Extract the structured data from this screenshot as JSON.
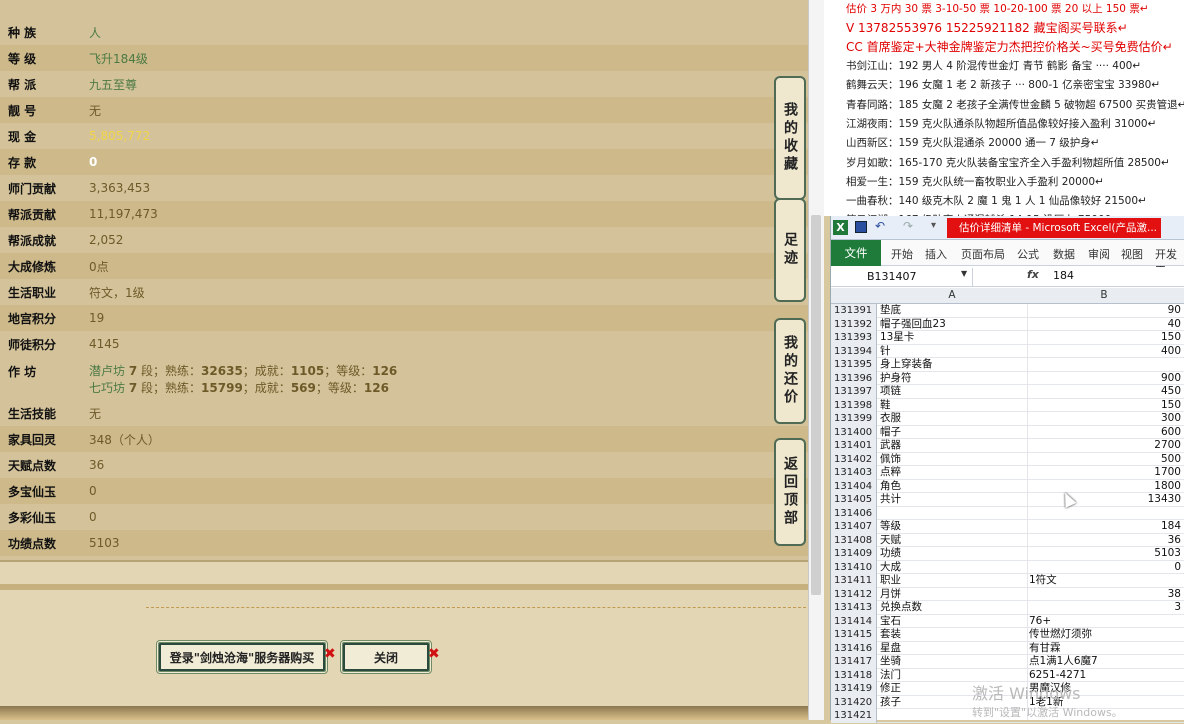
{
  "left_panel": {
    "rows": [
      {
        "label": "种 族",
        "value": "人"
      },
      {
        "label": "等 级",
        "value": "飞升184级"
      },
      {
        "label": "帮 派",
        "value": "九五至尊"
      },
      {
        "label": "靓 号",
        "value": "无"
      },
      {
        "label": "现 金",
        "value": "5,805,772"
      },
      {
        "label": "存 款",
        "value": "0"
      },
      {
        "label": "师门贡献",
        "value": "3,363,453"
      },
      {
        "label": "帮派贡献",
        "value": "11,197,473"
      },
      {
        "label": "帮派成就",
        "value": "2,052"
      },
      {
        "label": "大成修炼",
        "value": "0点"
      },
      {
        "label": "生活职业",
        "value": "符文，1级"
      },
      {
        "label": "地宫积分",
        "value": "19"
      },
      {
        "label": "师徒积分",
        "value": "4145"
      }
    ],
    "workshop": {
      "label": "作 坊",
      "line1": {
        "name": "潜卢坊",
        "level": "7",
        "level_suffix": "段；熟练：",
        "skill": "32635",
        "ach_label": "；成就：",
        "ach": "1105",
        "lv_label": "；等级：",
        "lv": "126"
      },
      "line2": {
        "name": "七巧坊",
        "level": "7",
        "level_suffix": "段；熟练：",
        "skill": "15799",
        "ach_label": "；成就：",
        "ach": "569",
        "lv_label": "；等级：",
        "lv": "126"
      }
    },
    "rows2": [
      {
        "label": "生活技能",
        "value": "无"
      },
      {
        "label": "家具回灵",
        "value": "348（个人）"
      },
      {
        "label": "天赋点数",
        "value": "36"
      },
      {
        "label": "多宝仙玉",
        "value": "0"
      },
      {
        "label": "多彩仙玉",
        "value": "0"
      },
      {
        "label": "功绩点数",
        "value": "5103"
      }
    ],
    "side_buttons": [
      "我的收藏",
      "足迹",
      "我的还价",
      "返回顶部"
    ],
    "login_button": "登录\"剑烛沧海\"服务器购买",
    "close_button": "关闭"
  },
  "right_text": {
    "line0": "估价 3 万内 30 票    3-10-50 票    10-20-100 票    20 以上 150 票↵",
    "line1": "V 13782553976    15225921182   藏宝阁买号联系↵",
    "line2": "CC 首席鉴定+大神金牌鉴定力杰把控价格关~买号免费估价↵",
    "lines": [
      "书剑江山：192 男人 4 阶混传世金灯 青节 鹤影 备宝 ···· 400↵",
      "鹤舞云天：196 女魔 1 老 2 新孩子 ··· 800-1 亿亲密宝宝 33980↵",
      "青春同路：185 女魔 2 老孩子全满传世金麟 5 破物超 67500 买贵管退↵",
      "江湖夜雨：159 克火队通杀队物超所值品像较好接入盈利 31000↵",
      "山西新区：159 克火队混通杀 20000 通一 7 级护身↵",
      "岁月如歌：165-170 克火队装备宝宝齐全入手盈利物超所值 28500↵",
      "相爱一生：159 克火队统一畜牧职业入手盈利 20000↵",
      "一曲春秋：140 级克木队 2 魔 1 鬼 1 人 1 仙品像较好 21500↵",
      "笑马江湖：167 级队克火通混辅杀 14-15 没压力 75000↵"
    ]
  },
  "excel": {
    "title": "估价详细清单 - Microsoft Excel(产品激...",
    "tabs": [
      "文件",
      "开始",
      "插入",
      "页面布局",
      "公式",
      "数据",
      "审阅",
      "视图",
      "开发工"
    ],
    "name_box": "B131407",
    "fx": "fx",
    "formula_value": "184",
    "col_a": "A",
    "col_b": "B",
    "rows": [
      {
        "n": "131391",
        "a": "垫底",
        "b": "90",
        "align": "r"
      },
      {
        "n": "131392",
        "a": "帽子强回血23",
        "b": "40",
        "align": "r"
      },
      {
        "n": "131393",
        "a": "13星卡",
        "b": "150",
        "align": "r"
      },
      {
        "n": "131394",
        "a": "针",
        "b": "400",
        "align": "r"
      },
      {
        "n": "131395",
        "a": "身上穿装备",
        "b": "",
        "align": "r"
      },
      {
        "n": "131396",
        "a": "护身符",
        "b": "900",
        "align": "r"
      },
      {
        "n": "131397",
        "a": "项链",
        "b": "450",
        "align": "r"
      },
      {
        "n": "131398",
        "a": "鞋",
        "b": "150",
        "align": "r"
      },
      {
        "n": "131399",
        "a": "衣服",
        "b": "300",
        "align": "r"
      },
      {
        "n": "131400",
        "a": "帽子",
        "b": "600",
        "align": "r"
      },
      {
        "n": "131401",
        "a": "武器",
        "b": "2700",
        "align": "r"
      },
      {
        "n": "131402",
        "a": "佩饰",
        "b": "500",
        "align": "r"
      },
      {
        "n": "131403",
        "a": "点粹",
        "b": "1700",
        "align": "r"
      },
      {
        "n": "131404",
        "a": "角色",
        "b": "1800",
        "align": "r"
      },
      {
        "n": "131405",
        "a": "共计",
        "b": "13430",
        "align": "r"
      },
      {
        "n": "131406",
        "a": "",
        "b": "",
        "align": "r"
      },
      {
        "n": "131407",
        "a": "等级",
        "b": "184",
        "align": "r"
      },
      {
        "n": "131408",
        "a": "天赋",
        "b": "36",
        "align": "r"
      },
      {
        "n": "131409",
        "a": "功绩",
        "b": "5103",
        "align": "r"
      },
      {
        "n": "131410",
        "a": "大成",
        "b": "0",
        "align": "r"
      },
      {
        "n": "131411",
        "a": "职业",
        "b": "1符文",
        "align": "l"
      },
      {
        "n": "131412",
        "a": "月饼",
        "b": "38",
        "align": "r"
      },
      {
        "n": "131413",
        "a": "兑换点数",
        "b": "3",
        "align": "r"
      },
      {
        "n": "131414",
        "a": "宝石",
        "b": "76+",
        "align": "l"
      },
      {
        "n": "131415",
        "a": "套装",
        "b": "传世燃灯须弥",
        "align": "l"
      },
      {
        "n": "131416",
        "a": "星盘",
        "b": "有甘霖",
        "align": "l"
      },
      {
        "n": "131417",
        "a": "坐骑",
        "b": "点1满1人6魔7",
        "align": "l"
      },
      {
        "n": "131418",
        "a": "法门",
        "b": "6251-4271",
        "align": "l"
      },
      {
        "n": "131419",
        "a": "修正",
        "b": "男魔汉修",
        "align": "l"
      },
      {
        "n": "131420",
        "a": "孩子",
        "b": "1老1新",
        "align": "l"
      },
      {
        "n": "131421",
        "a": "",
        "b": "",
        "align": "r"
      }
    ]
  },
  "watermark": {
    "line1": "激活 Windows",
    "line2": "转到\"设置\"以激活 Windows。"
  }
}
